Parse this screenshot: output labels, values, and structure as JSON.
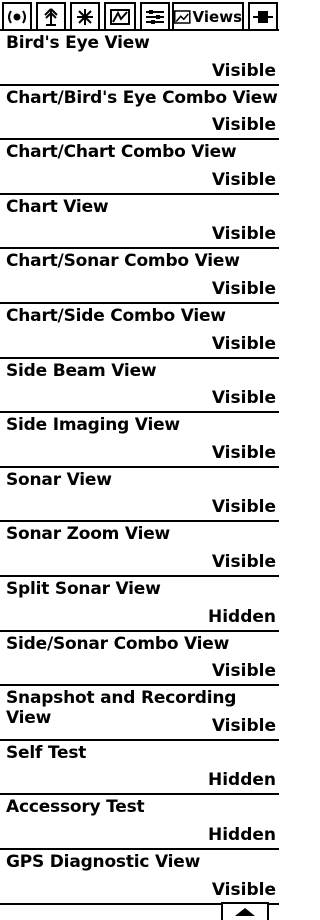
{
  "tabs": [
    {
      "icon": "alarm-sound-icon"
    },
    {
      "icon": "antenna-icon"
    },
    {
      "icon": "sonar-settings-icon"
    },
    {
      "icon": "chart-navigation-icon"
    },
    {
      "icon": "setup-sliders-icon"
    },
    {
      "icon": "views-icon",
      "label": "Views",
      "active": true
    },
    {
      "icon": "accessories-icon"
    }
  ],
  "views": [
    {
      "name": "Bird's Eye View",
      "value": "Visible"
    },
    {
      "name": "Chart/Bird's Eye Combo View",
      "value": "Visible"
    },
    {
      "name": "Chart/Chart Combo View",
      "value": "Visible"
    },
    {
      "name": "Chart View",
      "value": "Visible"
    },
    {
      "name": "Chart/Sonar Combo View",
      "value": "Visible"
    },
    {
      "name": "Chart/Side Combo View",
      "value": "Visible"
    },
    {
      "name": "Side Beam View",
      "value": "Visible"
    },
    {
      "name": "Side Imaging View",
      "value": "Visible"
    },
    {
      "name": "Sonar View",
      "value": "Visible"
    },
    {
      "name": "Sonar Zoom View",
      "value": "Visible"
    },
    {
      "name": "Split Sonar View",
      "value": "Hidden"
    },
    {
      "name": "Side/Sonar Combo View",
      "value": "Visible"
    },
    {
      "name": "Snapshot and Recording View",
      "value": "Visible"
    },
    {
      "name": "Self Test",
      "value": "Hidden"
    },
    {
      "name": "Accessory Test",
      "value": "Hidden"
    },
    {
      "name": "GPS Diagnostic View",
      "value": "Visible"
    }
  ],
  "scroll": {
    "icon": "scroll-up-arrow-icon"
  }
}
